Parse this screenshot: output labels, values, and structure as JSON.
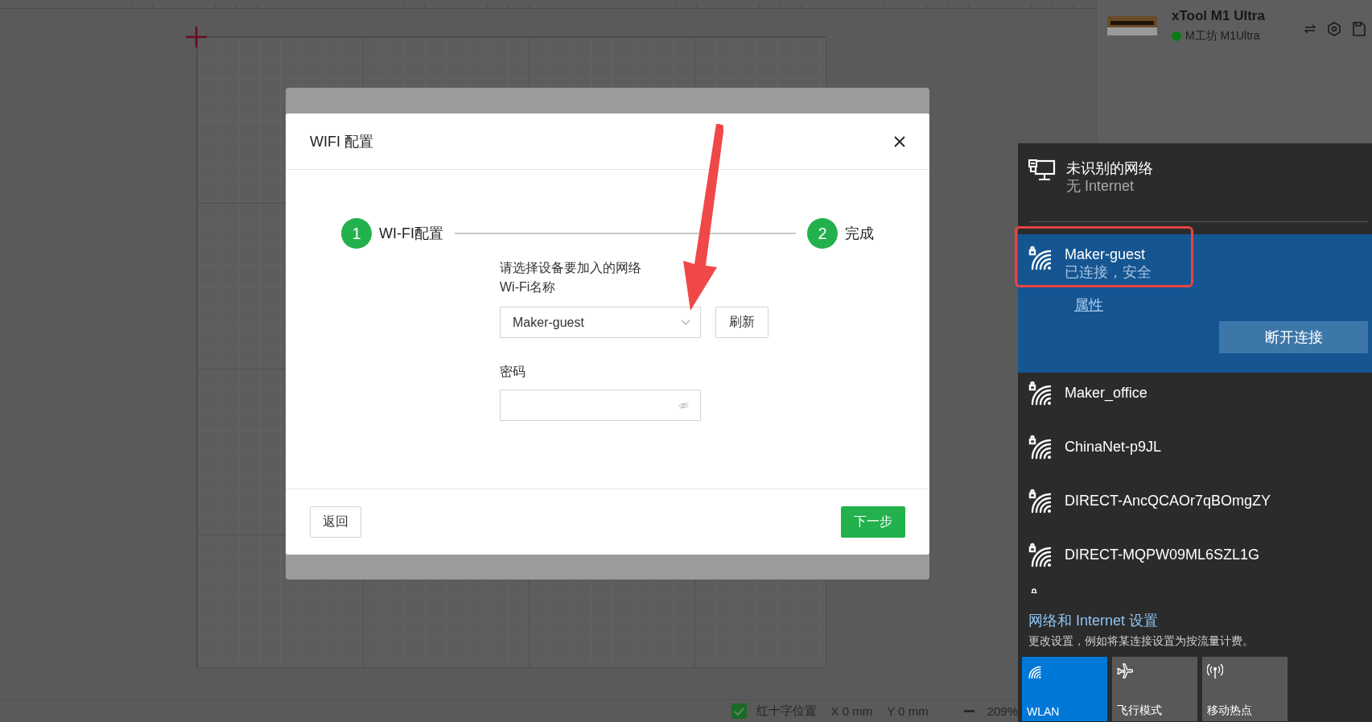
{
  "device": {
    "name": "xTool M1 Ultra",
    "status": "M工坊 M1Ultra",
    "online": true
  },
  "status_bar": {
    "crosshair": {
      "label": "红十字位置",
      "checked": true
    },
    "x": "X 0 mm",
    "y": "Y 0 mm",
    "zoom": "209%"
  },
  "dialog": {
    "title": "WIFI 配置",
    "steps": [
      {
        "number": "1",
        "label": "WI-FI配置"
      },
      {
        "number": "2",
        "label": "完成"
      }
    ],
    "prompt": "请选择设备要加入的网络",
    "network_label": "Wi-Fi名称",
    "network": {
      "value": "Maker-guest"
    },
    "refresh": "刷新",
    "password_label": "密码",
    "back": "返回",
    "next": "下一步"
  },
  "wifi_flyout": {
    "networks": [
      {
        "kind": "wired",
        "name": "未识别的网络",
        "status": "无 Internet",
        "selected": false
      },
      {
        "kind": "wifi",
        "name": "Maker-guest",
        "status": "已连接，安全",
        "selected": true,
        "properties": "属性",
        "action": "断开连接"
      },
      {
        "kind": "wifi",
        "name": "Maker_office",
        "selected": false
      },
      {
        "kind": "wifi",
        "name": "ChinaNet-p9JL",
        "selected": false
      },
      {
        "kind": "wifi",
        "name": "DIRECT-AncQCAOr7qBOmgZY",
        "selected": false
      },
      {
        "kind": "wifi",
        "name": "DIRECT-MQPW09ML6SZL1G",
        "selected": false
      }
    ],
    "settings_link": "网络和 Internet 设置",
    "settings_hint": "更改设置，例如将某连接设置为按流量计费。",
    "tiles": [
      {
        "kind": "wifi",
        "label": "WLAN",
        "on": true
      },
      {
        "kind": "airplane",
        "label": "飞行模式",
        "on": false
      },
      {
        "kind": "hotspot",
        "label": "移动热点",
        "on": false
      }
    ]
  },
  "annotations": {
    "arrow": true,
    "highlight_box": true
  }
}
